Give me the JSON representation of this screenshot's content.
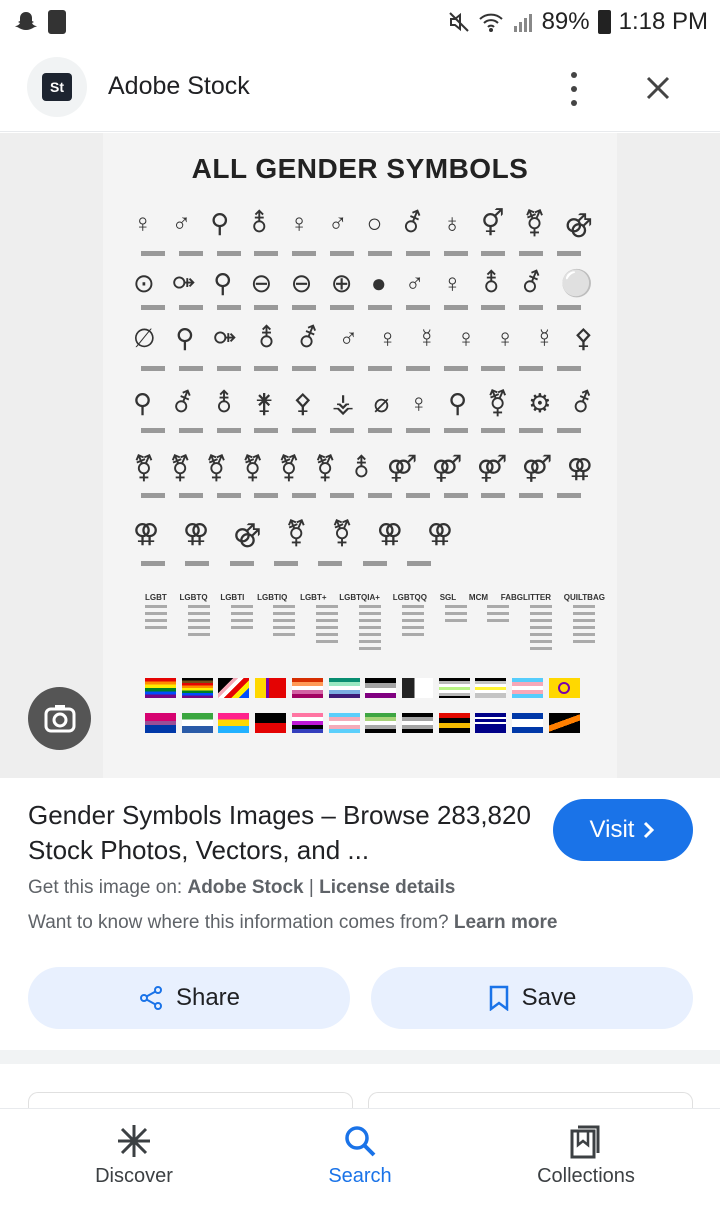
{
  "status_bar": {
    "battery": "89%",
    "time": "1:18 PM"
  },
  "header": {
    "logo_text": "St",
    "site_name": "Adobe Stock"
  },
  "image": {
    "poster_title": "ALL GENDER SYMBOLS",
    "acronyms": [
      "LGBT",
      "LGBTQ",
      "LGBTI",
      "LGBTIQ",
      "LGBT+",
      "LGBTQIA+",
      "LGBTQQ",
      "SGL",
      "MCM",
      "FABGLITTER",
      "QUILTBAG"
    ]
  },
  "result": {
    "title": "Gender Symbols Images – Browse 283,820 Stock Photos, Vectors, and ...",
    "visit_label": "Visit",
    "source_prefix": "Get this image on:",
    "source_name": "Adobe Stock",
    "separator": "|",
    "license_label": "License details",
    "learn_prefix": "Want to know where this information comes from?",
    "learn_label": "Learn more",
    "share_label": "Share",
    "save_label": "Save"
  },
  "bottom_nav": {
    "items": [
      {
        "label": "Discover",
        "icon": "asterisk-icon"
      },
      {
        "label": "Search",
        "icon": "search-icon",
        "active": true
      },
      {
        "label": "Collections",
        "icon": "collections-icon"
      }
    ]
  },
  "colors": {
    "accent": "#1a73e8",
    "button_bg": "#e8f0fe"
  }
}
